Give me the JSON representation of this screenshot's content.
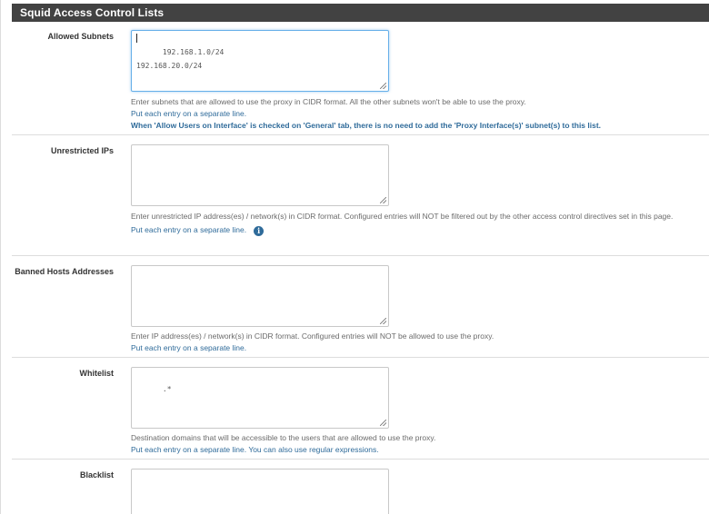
{
  "section": {
    "title": "Squid Access Control Lists"
  },
  "fields": {
    "allowed_subnets": {
      "label": "Allowed Subnets",
      "value": "192.168.1.0/24\n192.168.20.0/24",
      "help_line1": "Enter subnets that are allowed to use the proxy in CIDR format. All the other subnets won't be able to use the proxy.",
      "help_line2": "Put each entry on a separate line.",
      "help_line3": "When 'Allow Users on Interface' is checked on 'General' tab, there is no need to add the 'Proxy Interface(s)' subnet(s) to this list."
    },
    "unrestricted_ips": {
      "label": "Unrestricted IPs",
      "value": "",
      "help_line1": "Enter unrestricted IP address(es) / network(s) in CIDR format. Configured entries will NOT be filtered out by the other access control directives set in this page.",
      "help_line2": "Put each entry on a separate line."
    },
    "banned_hosts": {
      "label": "Banned Hosts Addresses",
      "value": "",
      "help_line1": "Enter IP address(es) / network(s) in CIDR format. Configured entries will NOT be allowed to use the proxy.",
      "help_line2": "Put each entry on a separate line."
    },
    "whitelist": {
      "label": "Whitelist",
      "value": ".*",
      "help_line1": "Destination domains that will be accessible to the users that are allowed to use the proxy.",
      "help_line2": "Put each entry on a separate line. You can also use regular expressions."
    },
    "blacklist": {
      "label": "Blacklist",
      "value": ""
    }
  },
  "icons": {
    "info": "info-circle-icon",
    "info_glyph": "i"
  },
  "colors": {
    "header_bg": "#424242",
    "header_text": "#ffffff",
    "help_blue": "#2f6b9a",
    "focus_border": "#66afe9"
  }
}
